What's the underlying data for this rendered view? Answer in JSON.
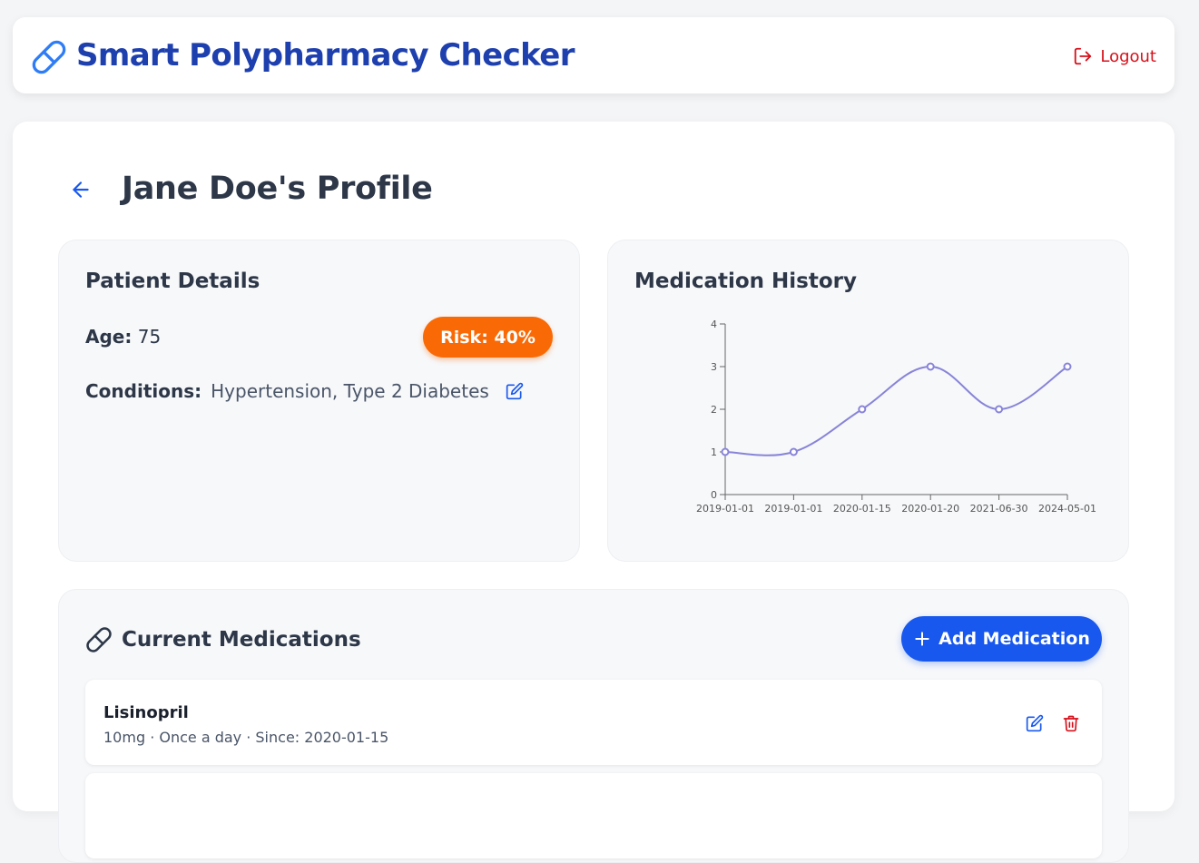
{
  "header": {
    "title": "Smart Polypharmacy Checker",
    "logout_label": "Logout"
  },
  "page": {
    "title": "Jane Doe's Profile"
  },
  "patient": {
    "card_title": "Patient Details",
    "age_label": "Age:",
    "age_value": "75",
    "risk_label": "Risk: 40%",
    "conditions_label": "Conditions:",
    "conditions_value": "Hypertension, Type 2 Diabetes"
  },
  "history": {
    "card_title": "Medication History"
  },
  "chart_data": {
    "type": "line",
    "categories": [
      "2019-01-01",
      "2019-01-01",
      "2020-01-15",
      "2020-01-20",
      "2021-06-30",
      "2024-05-01"
    ],
    "values": [
      1,
      1,
      2,
      3,
      2,
      3
    ],
    "ylim": [
      0,
      4
    ],
    "yticks": [
      "0",
      "1",
      "2",
      "3",
      "4"
    ],
    "grid": false,
    "line_color": "#8884d8"
  },
  "medications": {
    "title": "Current Medications",
    "add_label": "Add Medication",
    "items": [
      {
        "name": "Lisinopril",
        "detail": "10mg · Once a day · Since: 2020-01-15"
      }
    ]
  },
  "colors": {
    "brand": "#1e40af",
    "primary": "#1858ee",
    "danger": "#d6111b",
    "risk": "#f96a06"
  }
}
